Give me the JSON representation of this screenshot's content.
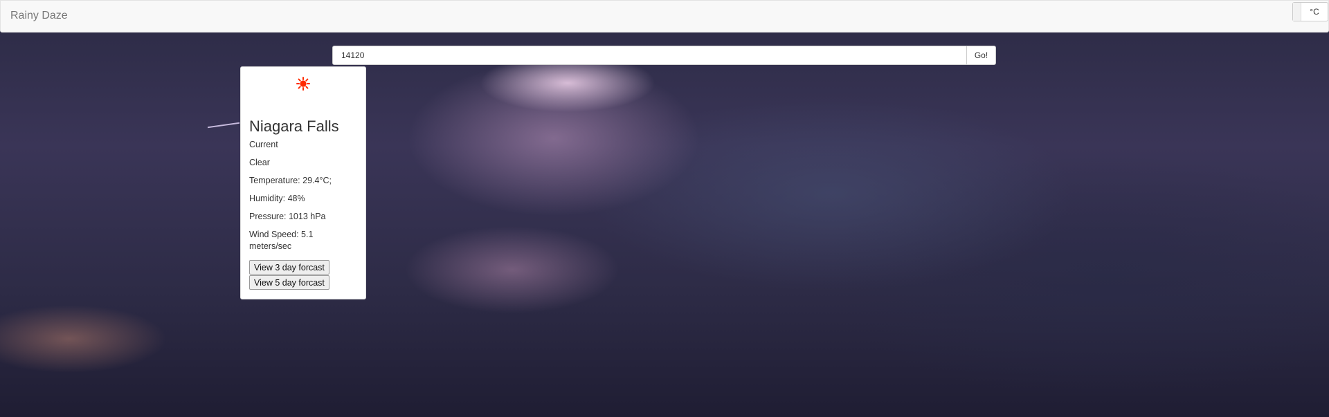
{
  "navbar": {
    "brand": "Rainy Daze",
    "unit_toggle_label": "°C"
  },
  "search": {
    "value": "14120",
    "button_label": "Go!"
  },
  "weather": {
    "icon": "sun-icon",
    "city": "Niagara Falls",
    "period": "Current",
    "condition": "Clear",
    "temperature": "Temperature: 29.4°C;",
    "humidity": "Humidity: 48%",
    "pressure": "Pressure: 1013 hPa",
    "wind_speed": "Wind Speed: 5.1 meters/sec",
    "btn_3day": "View 3 day forcast",
    "btn_5day": "View 5 day forcast"
  },
  "colors": {
    "sun": "#ff2a00",
    "navbar_bg": "#f8f8f8",
    "brand_text": "#777777"
  }
}
